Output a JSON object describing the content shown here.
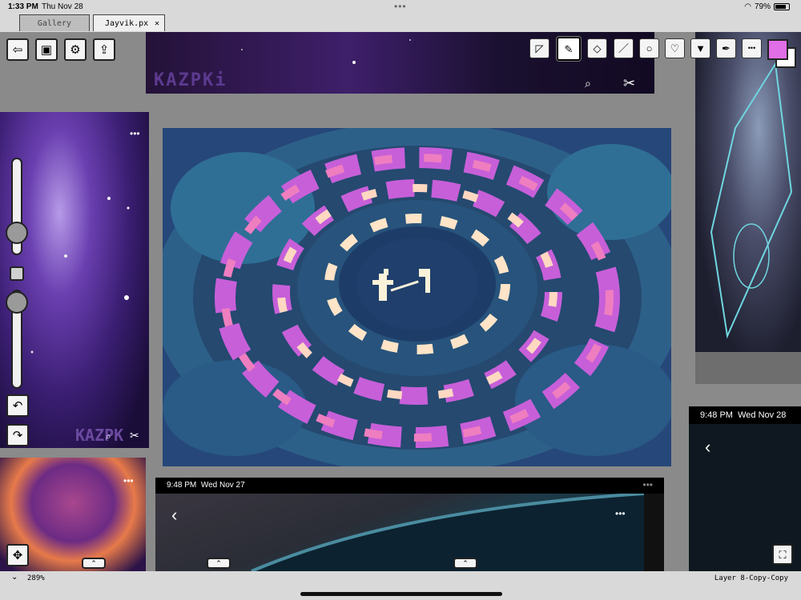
{
  "status": {
    "time": "1:33 PM",
    "date": "Thu Nov 28",
    "battery": "79%",
    "battery_level": 0.79
  },
  "tabs": {
    "gallery": "Gallery",
    "active": "Jayvik.px",
    "close": "✕"
  },
  "icons": {
    "back": "⇦",
    "image": "▣",
    "settings": "⚙",
    "export": "⇪",
    "select": "◸",
    "pencil": "✎",
    "eraser": "◇",
    "line": "／",
    "circle": "○",
    "lasso": "♡",
    "bucket": "▼",
    "eyedropper": "✒",
    "more": "•••",
    "zoom": "⌕",
    "scissors": "✂",
    "undo": "↶",
    "redo": "↷",
    "move": "✥",
    "chevron-up": "⌃",
    "back-chevron": "‹",
    "fullscreen": "⛶"
  },
  "colors": {
    "primary": "#e06ee6",
    "secondary": "#ffffff"
  },
  "references": {
    "top_watermark": "KAZPKi",
    "left_watermark": "KAZPK",
    "bottom_middle": {
      "time": "9:48 PM",
      "date": "Wed Nov 27"
    },
    "bottom_right": {
      "time": "9:48 PM",
      "date": "Wed Nov 28"
    }
  },
  "bottom": {
    "zoom": "289%",
    "layer": "Layer 8-Copy-Copy"
  }
}
